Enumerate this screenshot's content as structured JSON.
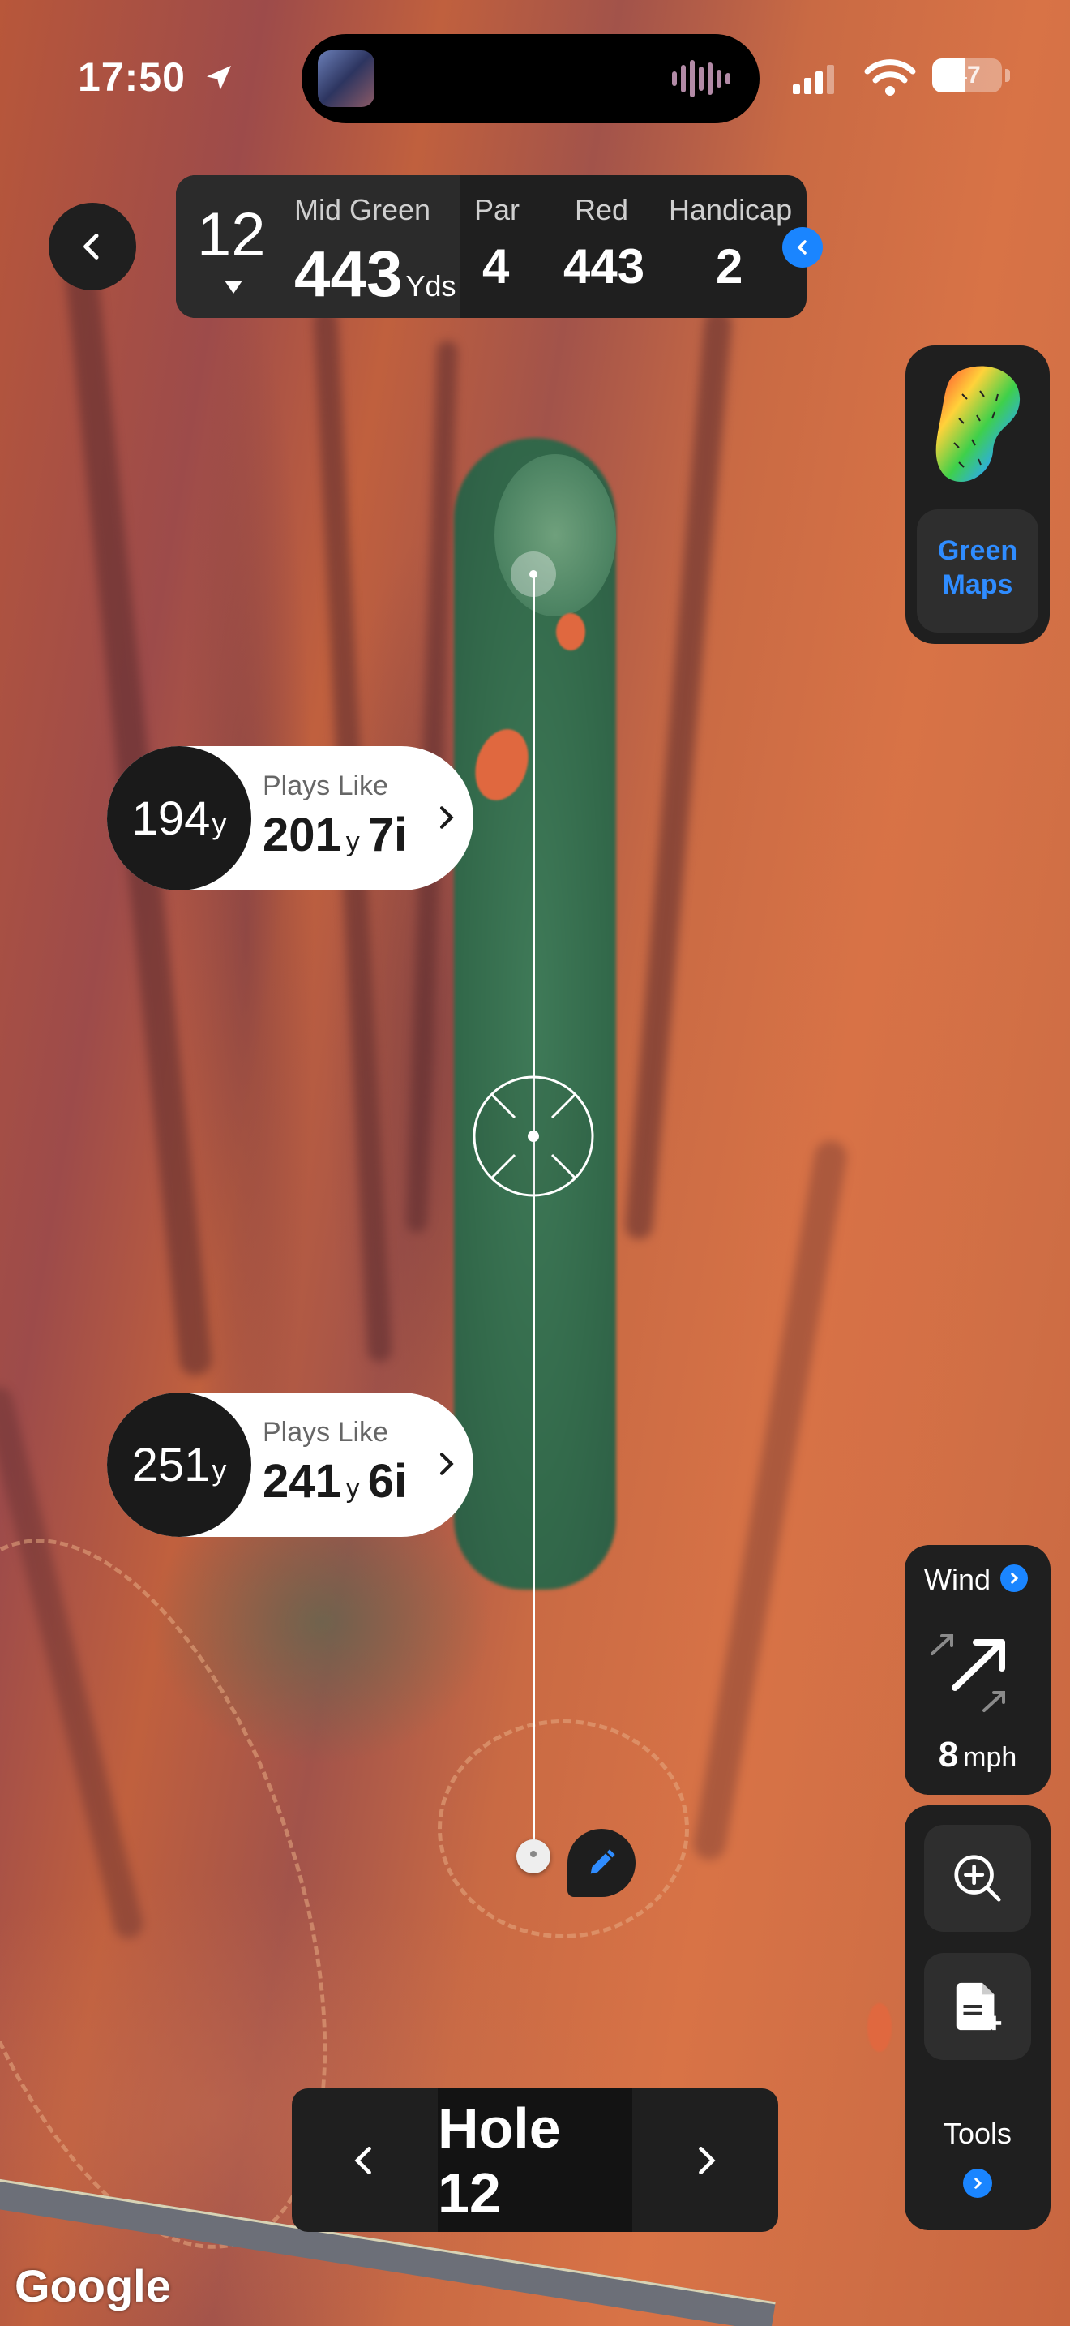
{
  "status_bar": {
    "time": "17:50",
    "battery": "47",
    "battery_level": 0.47
  },
  "hole_info": {
    "hole_number": "12",
    "distance_label": "Mid Green",
    "distance_value": "443",
    "distance_unit": "Yds",
    "par_label": "Par",
    "par_value": "4",
    "tee_label": "Red",
    "tee_value": "443",
    "handicap_label": "Handicap",
    "handicap_value": "2"
  },
  "green_maps": {
    "label_line1": "Green",
    "label_line2": "Maps",
    "accent": "#2f8cff"
  },
  "shots": [
    {
      "distance": "194",
      "unit": "y",
      "plays_like_label": "Plays Like",
      "plays_like": "201",
      "plays_like_unit": "y",
      "club": "7i"
    },
    {
      "distance": "251",
      "unit": "y",
      "plays_like_label": "Plays Like",
      "plays_like": "241",
      "plays_like_unit": "y",
      "club": "6i"
    }
  ],
  "wind": {
    "label": "Wind",
    "speed": "8",
    "unit": "mph"
  },
  "tools": {
    "label": "Tools"
  },
  "hole_nav": {
    "label": "Hole 12"
  },
  "map_attribution": "Google",
  "icons": [
    "back-icon",
    "location-arrow-icon",
    "signal-icon",
    "wifi-icon",
    "battery-icon",
    "chevron-left-icon",
    "green-heatmap-icon",
    "chevron-right-icon",
    "pencil-icon",
    "zoom-in-icon",
    "add-note-icon",
    "wind-arrow-icon",
    "info-icon"
  ]
}
